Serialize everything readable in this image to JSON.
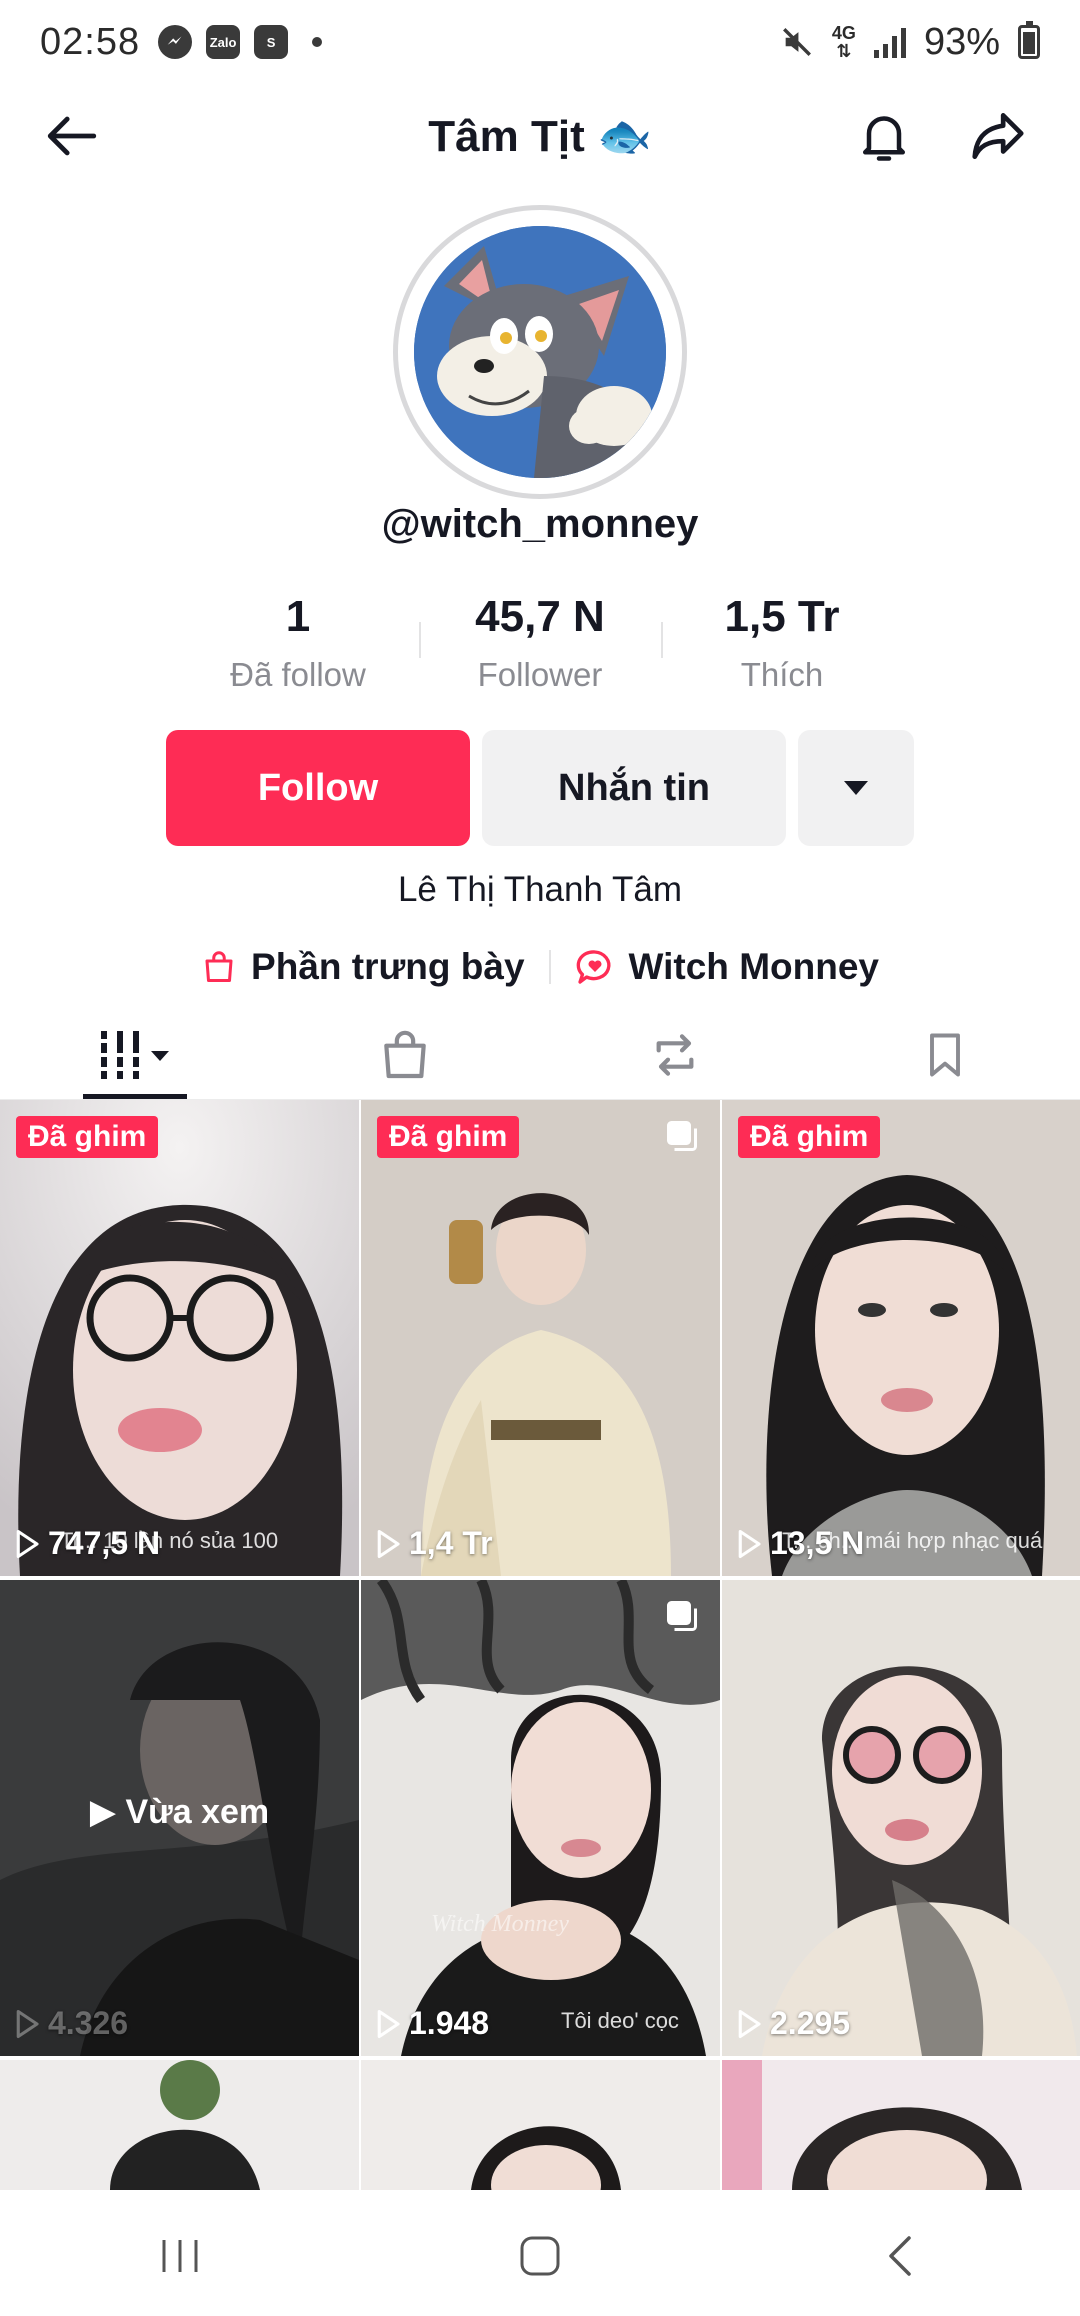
{
  "status_bar": {
    "time": "02:58",
    "apps": [
      "messenger",
      "Zalo",
      "shopee"
    ],
    "network": "4G",
    "battery": "93%"
  },
  "header": {
    "title": "Tâm Tịt 🐟"
  },
  "profile": {
    "username": "@witch_monney",
    "stats": [
      {
        "value": "1",
        "label": "Đã follow"
      },
      {
        "value": "45,7 N",
        "label": "Follower"
      },
      {
        "value": "1,5 Tr",
        "label": "Thích"
      }
    ],
    "follow_label": "Follow",
    "message_label": "Nhắn tin",
    "bio": "Lê Thị Thanh Tâm",
    "links": [
      {
        "label": "Phần trưng bày",
        "icon": "shopping-bag-icon"
      },
      {
        "label": "Witch Monney",
        "icon": "chat-heart-icon"
      }
    ]
  },
  "tabs": [
    {
      "name": "videos",
      "icon": "grid-icon",
      "active": true
    },
    {
      "name": "shop",
      "icon": "bag-icon",
      "active": false
    },
    {
      "name": "reposts",
      "icon": "repost-icon",
      "active": false
    },
    {
      "name": "favorites",
      "icon": "bookmark-icon",
      "active": false
    }
  ],
  "videos": [
    {
      "pinned_label": "Đã ghim",
      "views": "747,5 N",
      "caption": "Tr... 10 lần nó sủa 100"
    },
    {
      "pinned_label": "Đã ghim",
      "views": "1,4 Tr"
    },
    {
      "pinned_label": "Đã ghim",
      "views": "13,5 N",
      "caption": "T... ch... mái hợp nhạc quá"
    },
    {
      "views": "4.326",
      "recent_label": "▶ Vừa xem"
    },
    {
      "views": "1.948",
      "caption": "Tôi deo' cọc",
      "watermark": "Witch Monney"
    },
    {
      "views": "2.295"
    }
  ],
  "colors": {
    "accent": "#fe2c55",
    "button_grey": "#f1f1f2",
    "text_primary": "#161823",
    "text_secondary": "#8a8b91"
  }
}
